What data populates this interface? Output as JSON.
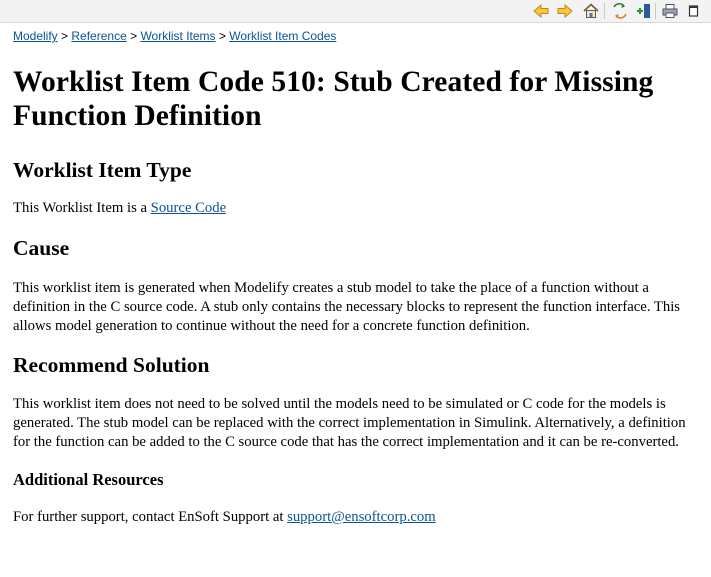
{
  "toolbar": {
    "icons": [
      "back-arrow-icon",
      "forward-arrow-icon",
      "home-icon",
      "sync-toc-icon",
      "bookmark-icon",
      "print-icon",
      "maximize-icon"
    ]
  },
  "breadcrumb": {
    "items": [
      "Modelify",
      "Reference",
      "Worklist Items",
      "Worklist Item Codes"
    ],
    "separator": ">"
  },
  "page": {
    "title": "Worklist Item Code 510: Stub Created for Missing Function Definition",
    "sections": {
      "type": {
        "heading": "Worklist Item Type",
        "text": "This Worklist Item is a ",
        "link": "Source Code"
      },
      "cause": {
        "heading": "Cause",
        "text": "This worklist item is generated when Modelify creates a stub model to take the place of a function without a definition in the C source code. A stub only contains the necessary blocks to represent the function interface. This allows model generation to continue without the need for a concrete function definition."
      },
      "solution": {
        "heading": "Recommend Solution",
        "text": "This worklist item does not need to be solved until the models need to be simulated or C code for the models is generated. The stub model can be replaced with the correct implementation in Simulink. Alternatively, a definition for the function can be added to the C source code that has the correct implementation and it can be re-converted."
      },
      "resources": {
        "heading": "Additional Resources",
        "text": "For further support, contact EnSoft Support at ",
        "link": "support@ensoftcorp.com"
      }
    }
  },
  "colors": {
    "link": "#0b5394",
    "toolbar_bg": "#f3f3f3"
  }
}
